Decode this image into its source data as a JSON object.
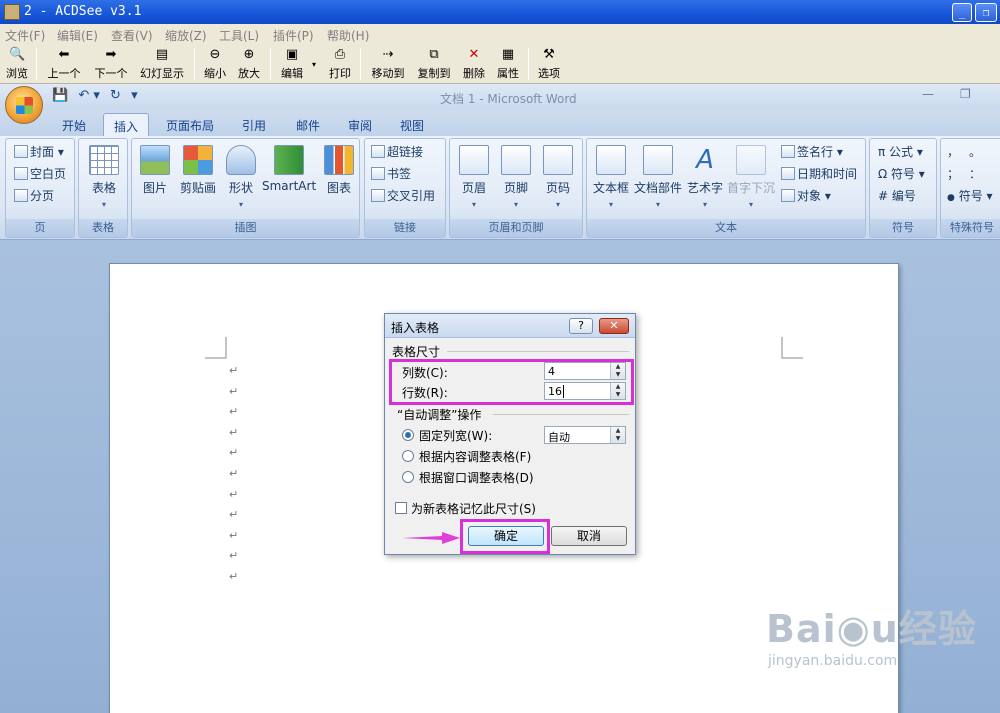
{
  "acdsee": {
    "title": "2 - ACDSee v3.1",
    "window_buttons": [
      "_",
      "❐",
      "✕"
    ],
    "menu": [
      "文件(F)",
      "编辑(E)",
      "查看(V)",
      "缩放(Z)",
      "工具(L)",
      "插件(P)",
      "帮助(H)"
    ],
    "toolbar": [
      {
        "label": "浏览",
        "icon": "browse-icon",
        "glyph": "🔍"
      },
      {
        "label": "上一个",
        "icon": "previous-icon",
        "glyph": "⬅"
      },
      {
        "label": "下一个",
        "icon": "next-icon",
        "glyph": "➡"
      },
      {
        "label": "幻灯显示",
        "icon": "slideshow-icon",
        "glyph": "▤"
      },
      {
        "label": "缩小",
        "icon": "zoom-out-icon",
        "glyph": "⊖"
      },
      {
        "label": "放大",
        "icon": "zoom-in-icon",
        "glyph": "⊕"
      },
      {
        "label": "编辑",
        "icon": "edit-icon",
        "glyph": "▣"
      },
      {
        "label": "打印",
        "icon": "print-icon",
        "glyph": "⎙"
      },
      {
        "label": "移动到",
        "icon": "move-to-icon",
        "glyph": "⇢"
      },
      {
        "label": "复制到",
        "icon": "copy-to-icon",
        "glyph": "⧉"
      },
      {
        "label": "删除",
        "icon": "delete-icon",
        "glyph": "✕"
      },
      {
        "label": "属性",
        "icon": "properties-icon",
        "glyph": "▦"
      },
      {
        "label": "选项",
        "icon": "options-icon",
        "glyph": "⚒"
      }
    ]
  },
  "word": {
    "title": "文档 1 - Microsoft Word",
    "qat": [
      "💾",
      "↶ ▾",
      "↻",
      "▾"
    ],
    "title_buttons": [
      "—",
      "❐"
    ],
    "tabs": [
      "开始",
      "插入",
      "页面布局",
      "引用",
      "邮件",
      "审阅",
      "视图"
    ],
    "active_tab": "插入",
    "groups": {
      "page": {
        "label": "页",
        "items": [
          "封面 ▾",
          "空白页",
          "分页"
        ]
      },
      "table": {
        "label": "表格",
        "button": "表格"
      },
      "illustrations": {
        "label": "插图",
        "buttons": [
          "图片",
          "剪贴画",
          "形状",
          "SmartArt",
          "图表"
        ]
      },
      "links": {
        "label": "链接",
        "items": [
          "超链接",
          "书签",
          "交叉引用"
        ]
      },
      "header_footer": {
        "label": "页眉和页脚",
        "buttons": [
          "页眉",
          "页脚",
          "页码"
        ]
      },
      "text": {
        "label": "文本",
        "buttons": [
          "文本框",
          "文档部件",
          "艺术字",
          "首字下沉"
        ],
        "items": [
          "签名行 ▾",
          "日期和时间",
          "对象 ▾"
        ]
      },
      "symbols": {
        "label": "符号",
        "items": [
          "π 公式 ▾",
          "Ω 符号 ▾",
          "# 编号"
        ]
      },
      "special": {
        "label": "特殊符号",
        "chars": [
          "，",
          "。",
          "、",
          "；",
          "：",
          "！"
        ],
        "item": "符号 ▾"
      }
    }
  },
  "document": {
    "paragraph_mark": "↵",
    "paragraph_count": 11
  },
  "dialog": {
    "title": "插入表格",
    "help": "?",
    "close": "✕",
    "size_section": "表格尺寸",
    "columns_label": "列数(C):",
    "columns_value": "4",
    "rows_label": "行数(R):",
    "rows_value": "16",
    "autofit_section": "“自动调整”操作",
    "fixed_width_label": "固定列宽(W):",
    "fixed_width_value": "自动",
    "autofit_content_label": "根据内容调整表格(F)",
    "autofit_window_label": "根据窗口调整表格(D)",
    "remember_label": "为新表格记忆此尺寸(S)",
    "ok": "确定",
    "cancel": "取消",
    "highlight_color": "#d630d6"
  },
  "watermark": {
    "brand": "Bai◉u经验",
    "url": "jingyan.baidu.com"
  }
}
